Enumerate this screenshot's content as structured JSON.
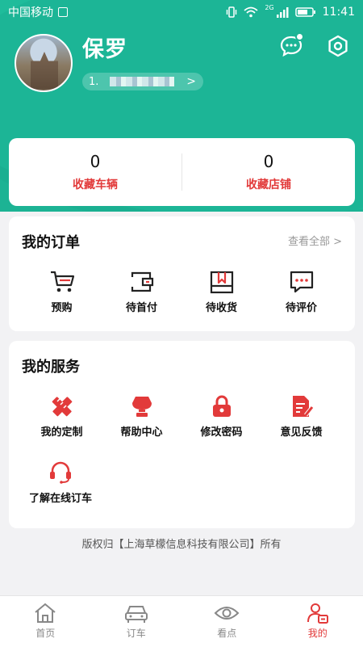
{
  "status_bar": {
    "carrier": "中国移动",
    "network": "2G",
    "time": "11:41"
  },
  "profile": {
    "username": "保罗",
    "phone_prefix": "1.",
    "phone_arrow": ">"
  },
  "favorites": [
    {
      "count": "0",
      "label": "收藏车辆"
    },
    {
      "count": "0",
      "label": "收藏店铺"
    }
  ],
  "orders": {
    "title": "我的订单",
    "view_all": "查看全部 >",
    "items": [
      {
        "label": "预购",
        "icon": "cart-icon"
      },
      {
        "label": "待首付",
        "icon": "wallet-icon"
      },
      {
        "label": "待收货",
        "icon": "box-icon"
      },
      {
        "label": "待评价",
        "icon": "comment-icon"
      }
    ]
  },
  "services": {
    "title": "我的服务",
    "items": [
      {
        "label": "我的定制",
        "icon": "pencil-ruler-icon"
      },
      {
        "label": "帮助中心",
        "icon": "help-icon"
      },
      {
        "label": "修改密码",
        "icon": "lock-icon"
      },
      {
        "label": "意见反馈",
        "icon": "feedback-icon"
      },
      {
        "label": "了解在线订车",
        "icon": "headset-icon"
      }
    ]
  },
  "copyright": "版权归【上海草檬信息科技有限公司】所有",
  "tabs": [
    {
      "label": "首页",
      "icon": "home-icon",
      "active": false
    },
    {
      "label": "订车",
      "icon": "car-icon",
      "active": false
    },
    {
      "label": "看点",
      "icon": "eye-icon",
      "active": false
    },
    {
      "label": "我的",
      "icon": "profile-icon",
      "active": true
    }
  ],
  "colors": {
    "header": "#1cb394",
    "accent_red": "#e23a3a",
    "background": "#f2f2f4"
  }
}
